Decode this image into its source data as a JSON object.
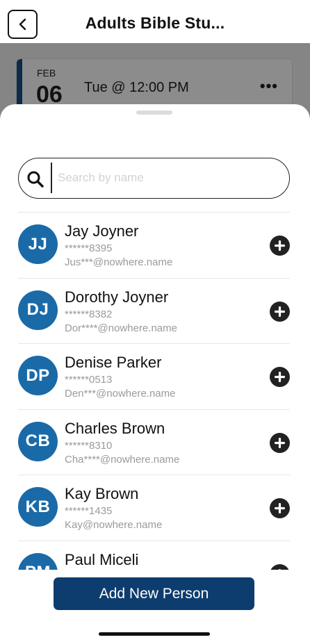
{
  "header": {
    "title": "Adults Bible Stu...",
    "back_icon": "chevron-left-icon"
  },
  "event": {
    "month": "FEB",
    "day": "06",
    "time": "Tue @ 12:00 PM",
    "more_label": "•••"
  },
  "search": {
    "placeholder": "Search by name",
    "value": ""
  },
  "people": [
    {
      "initials": "JJ",
      "name": "Jay Joyner",
      "phone": "******8395",
      "email": "Jus***@nowhere.name"
    },
    {
      "initials": "DJ",
      "name": "Dorothy Joyner",
      "phone": "******8382",
      "email": "Dor****@nowhere.name"
    },
    {
      "initials": "DP",
      "name": "Denise Parker",
      "phone": "******0513",
      "email": "Den***@nowhere.name"
    },
    {
      "initials": "CB",
      "name": "Charles Brown",
      "phone": "******8310",
      "email": "Cha****@nowhere.name"
    },
    {
      "initials": "KB",
      "name": "Kay Brown",
      "phone": "******1435",
      "email": "Kay@nowhere.name"
    },
    {
      "initials": "PM",
      "name": "Paul Miceli",
      "phone": "",
      "email": ""
    }
  ],
  "footer": {
    "add_person_label": "Add New Person"
  },
  "colors": {
    "avatar": "#1a6aa8",
    "primary_button": "#0d3d6e",
    "event_accent": "#0d2a48"
  }
}
